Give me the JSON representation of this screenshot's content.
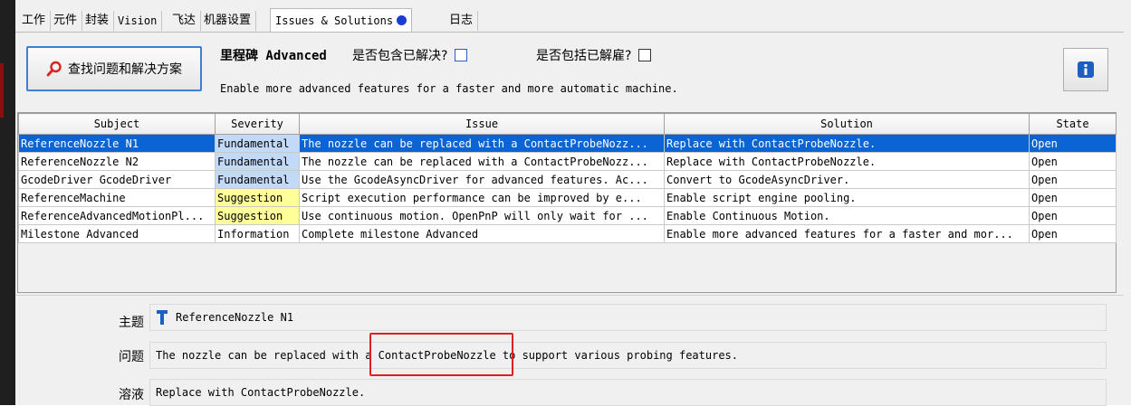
{
  "tabs": [
    {
      "label": "工作"
    },
    {
      "label": "元件"
    },
    {
      "label": "封装"
    },
    {
      "label": "Vision"
    },
    {
      "label": "飞达"
    },
    {
      "label": "机器设置"
    },
    {
      "label": "Issues & Solutions"
    },
    {
      "label": "日志"
    }
  ],
  "active_tab": "Issues & Solutions",
  "toolbar": {
    "find_button_label": "查找问题和解决方案",
    "milestone_label": "里程碑 Advanced",
    "include_solved_label": "是否包含已解决?",
    "include_dismissed_label": "是否包括已解雇?",
    "description": "Enable more advanced features for a faster and more automatic machine."
  },
  "table": {
    "columns": [
      "Subject",
      "Severity",
      "Issue",
      "Solution",
      "State"
    ],
    "rows": [
      {
        "subject": "ReferenceNozzle N1",
        "severity": "Fundamental",
        "issue": "The nozzle can be replaced with a ContactProbeNozz...",
        "solution": "Replace with ContactProbeNozzle.",
        "state": "Open"
      },
      {
        "subject": "ReferenceNozzle N2",
        "severity": "Fundamental",
        "issue": "The nozzle can be replaced with a ContactProbeNozz...",
        "solution": "Replace with ContactProbeNozzle.",
        "state": "Open"
      },
      {
        "subject": "GcodeDriver GcodeDriver",
        "severity": "Fundamental",
        "issue": "Use the GcodeAsyncDriver for advanced features. Ac...",
        "solution": "Convert to GcodeAsyncDriver.",
        "state": "Open"
      },
      {
        "subject": "ReferenceMachine",
        "severity": "Suggestion",
        "issue": "Script execution performance can be improved by e...",
        "solution": "Enable script engine pooling.",
        "state": "Open"
      },
      {
        "subject": "ReferenceAdvancedMotionPl...",
        "severity": "Suggestion",
        "issue": "Use continuous motion. OpenPnP will only wait for ...",
        "solution": "Enable Continuous Motion.",
        "state": "Open"
      },
      {
        "subject": "Milestone Advanced",
        "severity": "Information",
        "issue": "Complete milestone Advanced",
        "solution": "Enable more advanced features for a faster and mor...",
        "state": "Open"
      }
    ]
  },
  "detail": {
    "subject_label": "主题",
    "subject_value": "ReferenceNozzle N1",
    "issue_label": "问题",
    "issue_value": "The nozzle can be replaced with a ContactProbeNozzle to support various probing features.",
    "solution_label": "溶液",
    "solution_value": "Replace with ContactProbeNozzle."
  },
  "colors": {
    "selected_row": "#0a64d4",
    "fundamental": "#c2d9f7",
    "suggestion": "#ffff99",
    "highlight_box": "#e0201e",
    "tab_dot": "#1a3fd0"
  },
  "icons": {
    "find": "search-icon",
    "info": "info-icon",
    "subject": "nozzle-icon"
  }
}
